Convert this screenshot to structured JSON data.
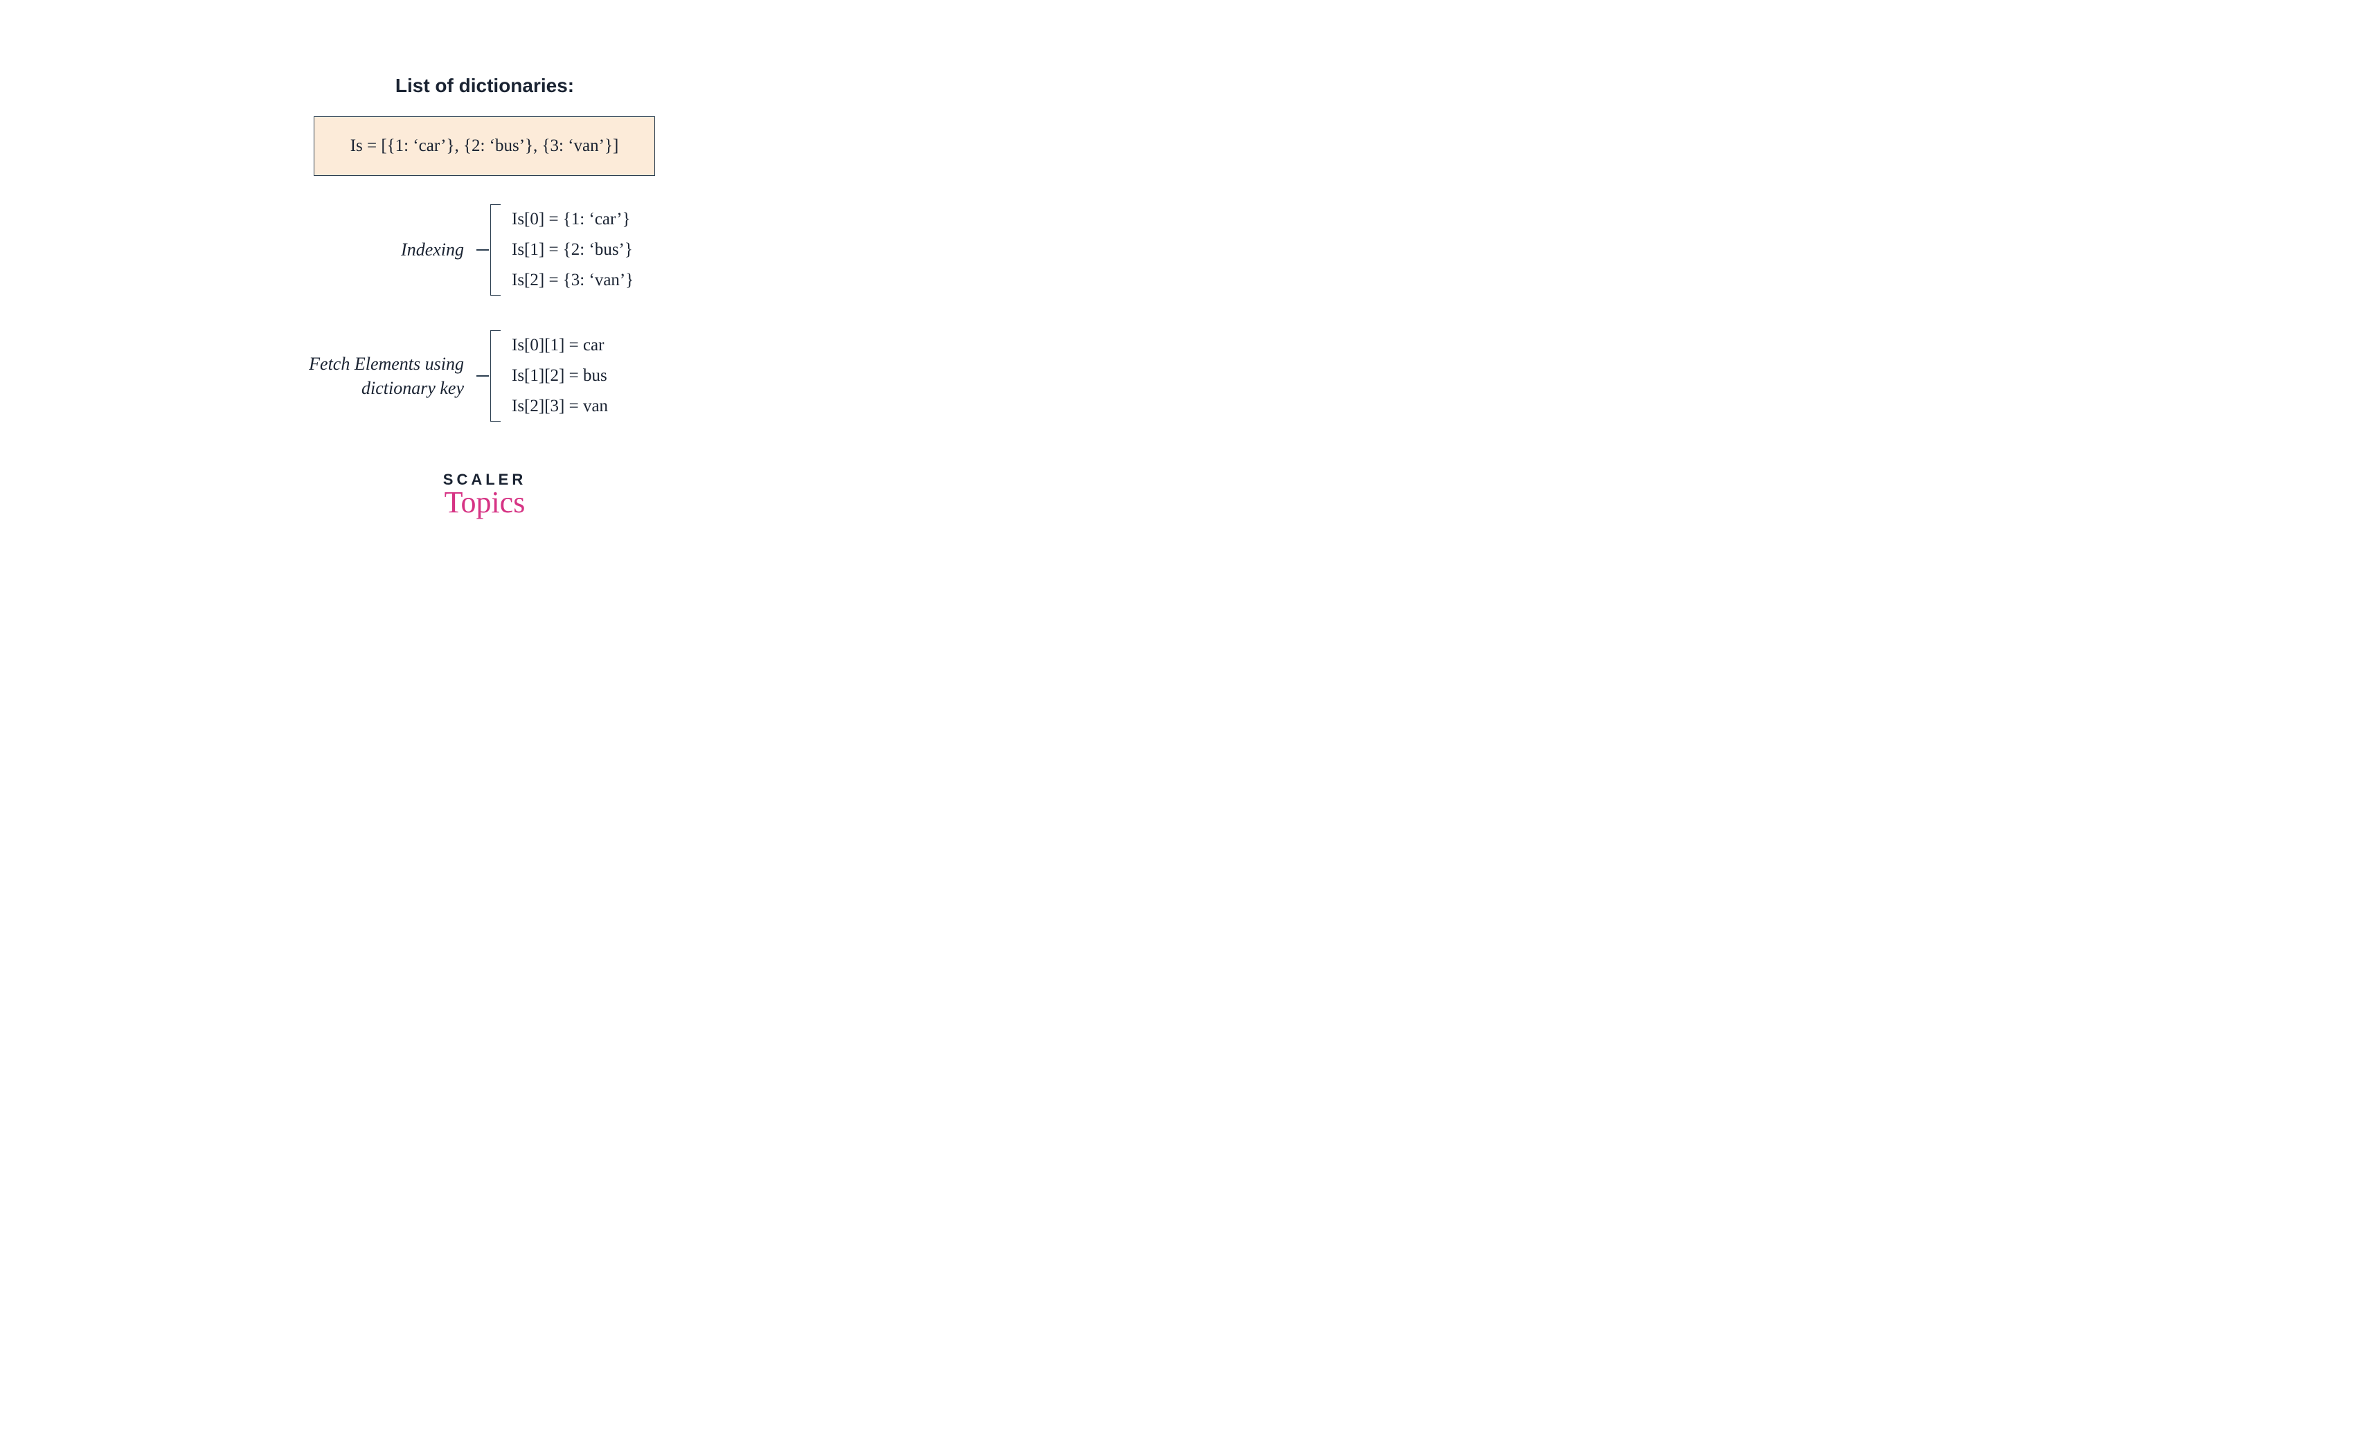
{
  "title": "List of dictionaries:",
  "code": "Is = [{1: ‘car’}, {2: ‘bus’}, {3: ‘van’}]",
  "indexing": {
    "label": "Indexing",
    "items": [
      "Is[0] = {1: ‘car’}",
      "Is[1] = {2: ‘bus’}",
      "Is[2] = {3: ‘van’}"
    ]
  },
  "fetch": {
    "label_line1": "Fetch Elements using",
    "label_line2": "dictionary key",
    "items": [
      "Is[0][1] = car",
      "Is[1][2] = bus",
      "Is[2][3] = van"
    ]
  },
  "logo": {
    "main": "SCALER",
    "sub": "Topics"
  }
}
